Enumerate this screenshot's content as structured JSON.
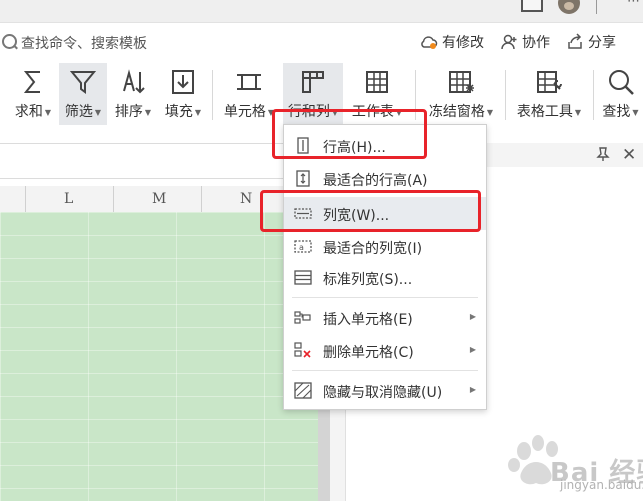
{
  "search": {
    "placeholder": "查找命令、搜索模板"
  },
  "actions": {
    "revise": "有修改",
    "collab": "协作",
    "share": "分享"
  },
  "ribbon": {
    "sum": "求和",
    "filter": "筛选",
    "sort": "排序",
    "fill": "填充",
    "cell": "单元格",
    "rowcol": "行和列",
    "sheet": "工作表",
    "freeze": "冻结窗格",
    "tools": "表格工具",
    "find": "查找"
  },
  "grid": {
    "columns": [
      "L",
      "M",
      "N"
    ]
  },
  "menu": {
    "items": [
      {
        "label": "行高(H)...",
        "icon": "row-height-icon"
      },
      {
        "label": "最适合的行高(A)",
        "icon": "best-fit-row-icon"
      },
      {
        "label": "列宽(W)...",
        "icon": "column-width-icon"
      },
      {
        "label": "最适合的列宽(I)",
        "icon": "best-fit-column-icon"
      },
      {
        "label": "标准列宽(S)...",
        "icon": "standard-width-icon"
      },
      {
        "label": "插入单元格(E)",
        "icon": "insert-cell-icon"
      },
      {
        "label": "删除单元格(C)",
        "icon": "delete-cell-icon"
      },
      {
        "label": "隐藏与取消隐藏(U)",
        "icon": "hide-unhide-icon"
      }
    ]
  },
  "watermark": {
    "brand": "Bai 经验",
    "url": "jingyan.baidu.com"
  },
  "colors": {
    "highlight": "#e8232a",
    "sheet_fill": "#c9e6c8"
  }
}
